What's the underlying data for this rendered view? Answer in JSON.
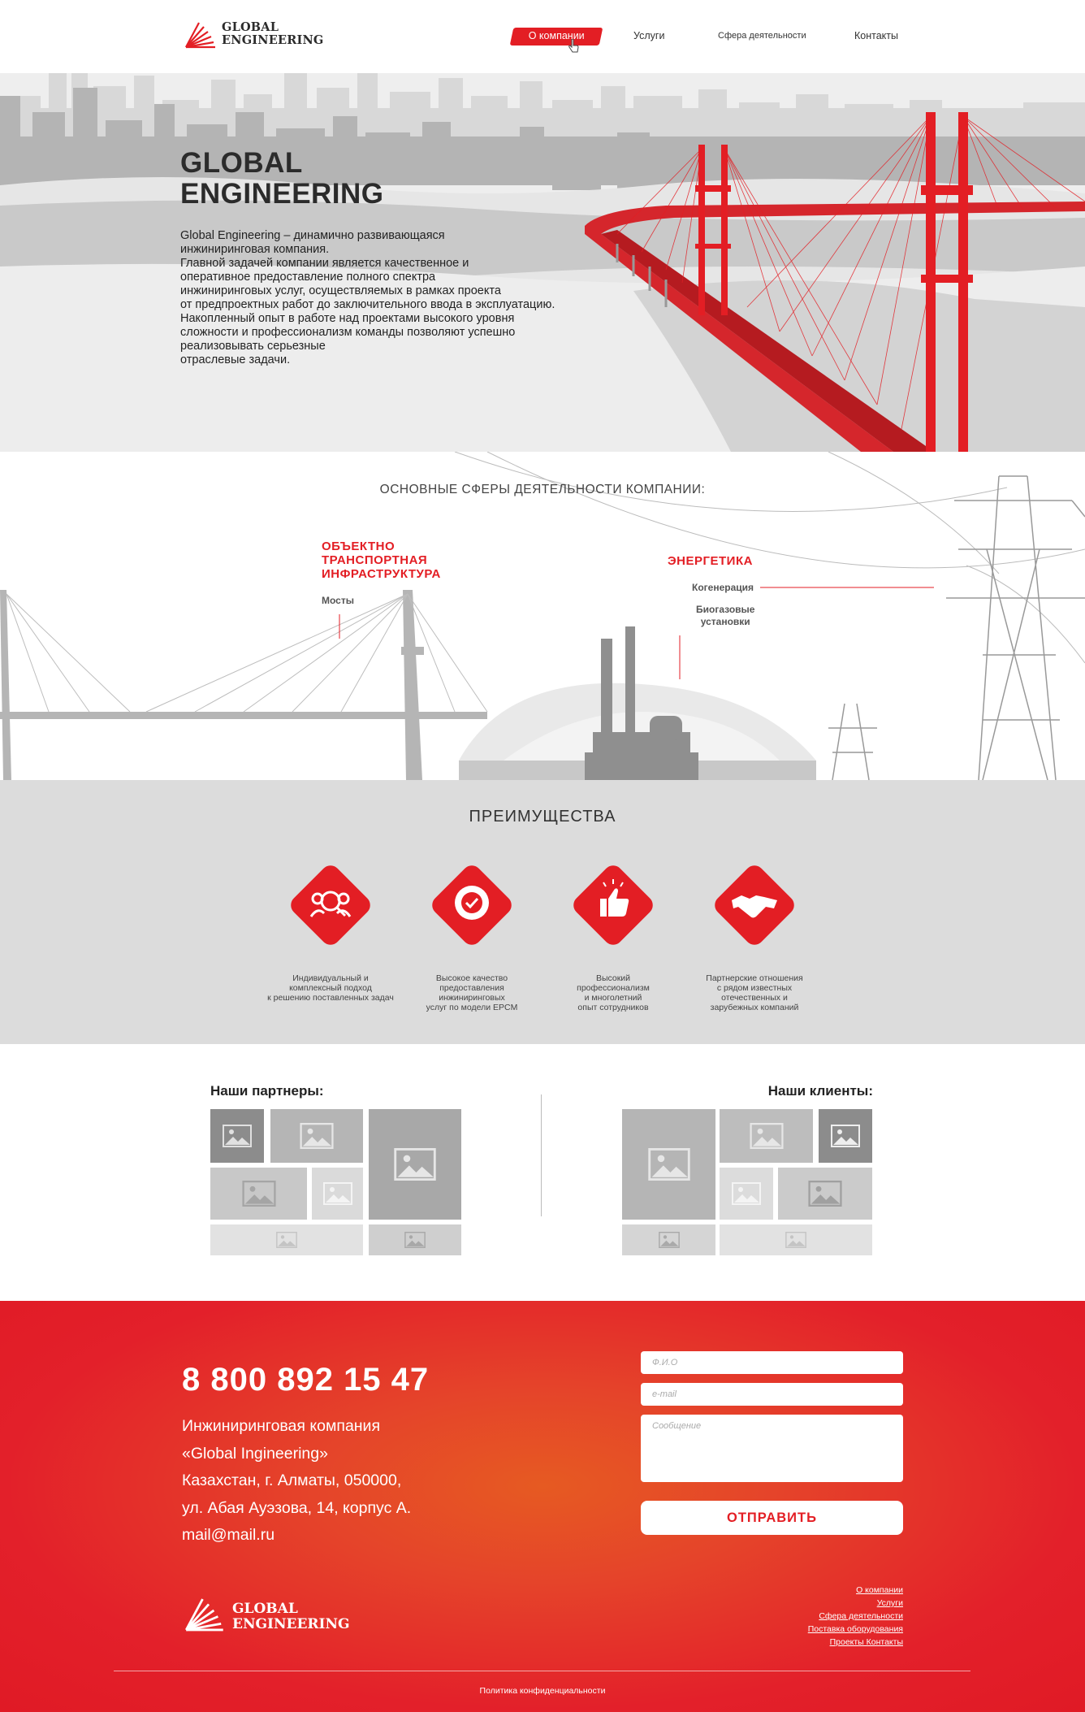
{
  "header": {
    "logo_line1": "GLOBAL",
    "logo_line2": "ENGINEERING",
    "nav": [
      "О компании",
      "Услуги",
      "Сфера деятельности",
      "Контакты"
    ]
  },
  "hero": {
    "title_line1": "GLOBAL",
    "title_line2": "ENGINEERING",
    "text": [
      "Global Engineering – динамично развивающаяся",
      "инжиниринговая компания.",
      "Главной задачей компании является качественное и",
      "оперативное предоставление полного спектра",
      "инжиниринговых услуг, осуществляемых в рамках проекта",
      "от предпроектных работ до заключительного ввода в эксплуатацию.",
      "Накопленный опыт в работе над проектами высокого уровня",
      "сложности и профессионализм команды позволяют успешно",
      "реализовывать серьезные",
      "отраслевые задачи."
    ]
  },
  "spheres": {
    "title": "ОСНОВНЫЕ СФЕРЫ ДЕЯТЕЛЬНОСТИ КОМПАНИИ:",
    "transport": [
      "ОБЪЕКТНО",
      "ТРАНСПОРТНАЯ",
      "ИНФРАСТРУКТУРА"
    ],
    "bridges": "Мосты",
    "energy": "ЭНЕРГЕТИКА",
    "cogeneration": "Когенерация",
    "biogas_line1": "Биогазовые",
    "biogas_line2": "установки"
  },
  "advantages": {
    "title": "ПРЕИМУЩЕСТВА",
    "items": [
      {
        "icon": "team-search-icon",
        "lines": [
          "Индивидуальный и",
          "комплексный подход",
          "к решению поставленных задач"
        ]
      },
      {
        "icon": "quality-badge-icon",
        "lines": [
          "Высокое качество",
          "предоставления",
          "инжиниринговых",
          "услуг по модели EPCM"
        ]
      },
      {
        "icon": "thumbs-up-icon",
        "lines": [
          "Высокий",
          "профессионализм",
          "и многолетний",
          "опыт сотрудников"
        ]
      },
      {
        "icon": "handshake-icon",
        "lines": [
          "Партнерские отношения",
          "с рядом известных",
          "отечественных и",
          "зарубежных компаний"
        ]
      }
    ]
  },
  "partners": {
    "partners_title": "Наши партнеры:",
    "clients_title": "Наши клиенты:"
  },
  "footer": {
    "phone": "8 800 892 15 47",
    "address": [
      "Инжиниринговая компания",
      "«Global Ingineering»",
      "Казахстан, г. Алматы, 050000,",
      "ул. Абая Ауэзова, 14, корпус А.",
      "mail@mail.ru"
    ],
    "name_placeholder": "Ф.И.О",
    "email_placeholder": "e-mail",
    "message_placeholder": "Сообщение",
    "send_label": "ОТПРАВИТЬ",
    "links": [
      "О компании",
      "Услуги",
      "Сфера деятельности",
      "Поставка оборудования",
      "Проекты Контакты"
    ],
    "logo_line1": "GLOBAL",
    "logo_line2": "ENGINEERING",
    "policy": "Политика конфиденциальности"
  },
  "colors": {
    "accent": "#e31e24",
    "gray_bg": "#dcdcdc"
  }
}
